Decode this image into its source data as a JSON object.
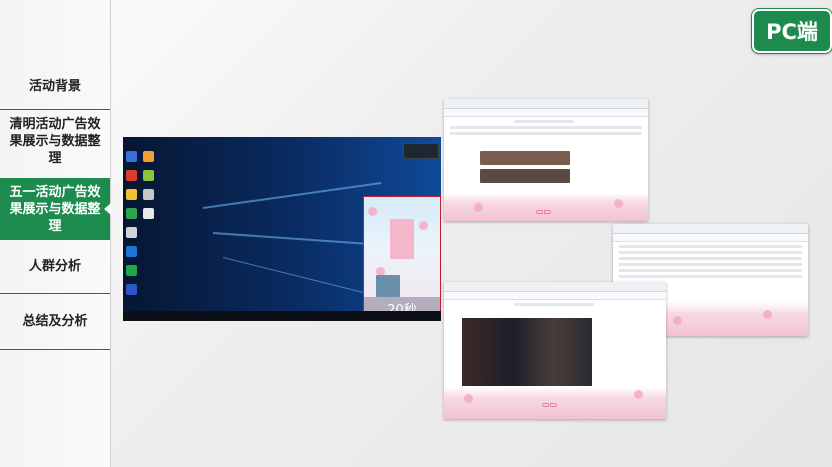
{
  "sidebar": {
    "items": [
      {
        "label": "活动背景",
        "active": false
      },
      {
        "label": "清明活动广告效果展示与数据整理",
        "active": false
      },
      {
        "label": "五一活动广告效果展示与数据整理",
        "active": true
      },
      {
        "label": "人群分析",
        "active": false
      },
      {
        "label": "总结及分析",
        "active": false
      }
    ]
  },
  "badge": {
    "label": "PC端"
  },
  "desktop": {
    "ad_timer": "20秒"
  },
  "colors": {
    "accent": "#1d8a4e",
    "highlight_border": "#c01f2c"
  }
}
